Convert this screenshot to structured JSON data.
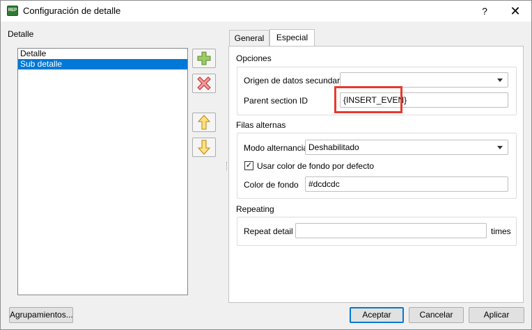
{
  "window": {
    "title": "Configuración de detalle",
    "icon_text": "REP",
    "help_label": "?",
    "close_label": "✕"
  },
  "left": {
    "section_label": "Detalle",
    "items": [
      "Detalle",
      "Sub detalle"
    ],
    "selected_index": 1,
    "tools": [
      "add-icon",
      "delete-icon",
      "move-up-icon",
      "move-down-icon"
    ]
  },
  "tabs": [
    {
      "label": "General",
      "active": false
    },
    {
      "label": "Especial",
      "active": true
    }
  ],
  "opciones": {
    "title": "Opciones",
    "origen_label": "Origen de datos secundario",
    "origen_value": "",
    "parent_label": "Parent section ID",
    "parent_value": "{INSERT_EVEN}"
  },
  "filas": {
    "title": "Filas alternas",
    "modo_label": "Modo alternancia",
    "modo_value": "Deshabilitado",
    "usar_color_label": "Usar color de fondo por defecto",
    "usar_color_checked": true,
    "color_label": "Color de fondo",
    "color_value": "#dcdcdc"
  },
  "repeating": {
    "title": "Repeating",
    "repeat_label": "Repeat detail",
    "repeat_value": "",
    "times_label": "times"
  },
  "buttons": {
    "agrupamientos": "Agrupamientos...",
    "aceptar": "Aceptar",
    "cancelar": "Cancelar",
    "aplicar": "Aplicar"
  },
  "colors": {
    "selection": "#0078d7",
    "highlight_box": "#e8392b",
    "add_icon": "#8bc34a",
    "delete_icon": "#e57373",
    "arrow_icon": "#f5c518"
  }
}
